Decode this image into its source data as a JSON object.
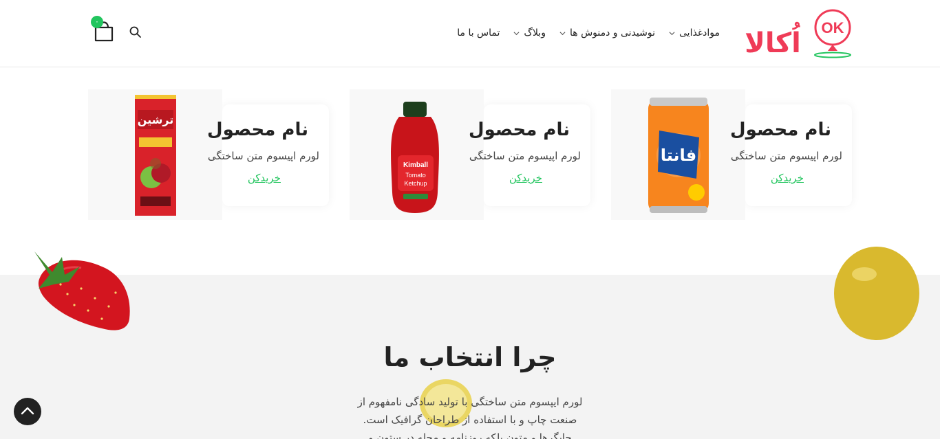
{
  "header": {
    "nav": [
      {
        "label": "موادغذایی",
        "has_dropdown": true
      },
      {
        "label": "نوشیدنی و دمنوش ها",
        "has_dropdown": true
      },
      {
        "label": "وبلاگ",
        "has_dropdown": true
      },
      {
        "label": "تماس با ما",
        "has_dropdown": false
      }
    ],
    "cart_count": "۰",
    "logo_text": "اُکالا",
    "brand_color": "#ef3b57",
    "accent_color": "#22c55e"
  },
  "products": [
    {
      "title": "نام محصول",
      "desc": "لورم اپیسوم متن ساختگی",
      "buy": "خریدکن",
      "image": "fanta-can"
    },
    {
      "title": "نام محصول",
      "desc": "لورم اپیسوم متن ساختگی",
      "buy": "خریدکن",
      "image": "ketchup-bottle"
    },
    {
      "title": "نام محصول",
      "desc": "لورم اپیسوم متن ساختگی",
      "buy": "خریدکن",
      "image": "fruit-roll-box"
    }
  ],
  "why": {
    "title": "چرا انتخاب ما",
    "text": "لورم ایپسوم متن ساختگی با تولید سادگی نامفهوم از صنعت چاپ و با استفاده از طراحان گرافیک است. چاپگرها و متون بلکه روزنامه و مجله در ستون و"
  }
}
